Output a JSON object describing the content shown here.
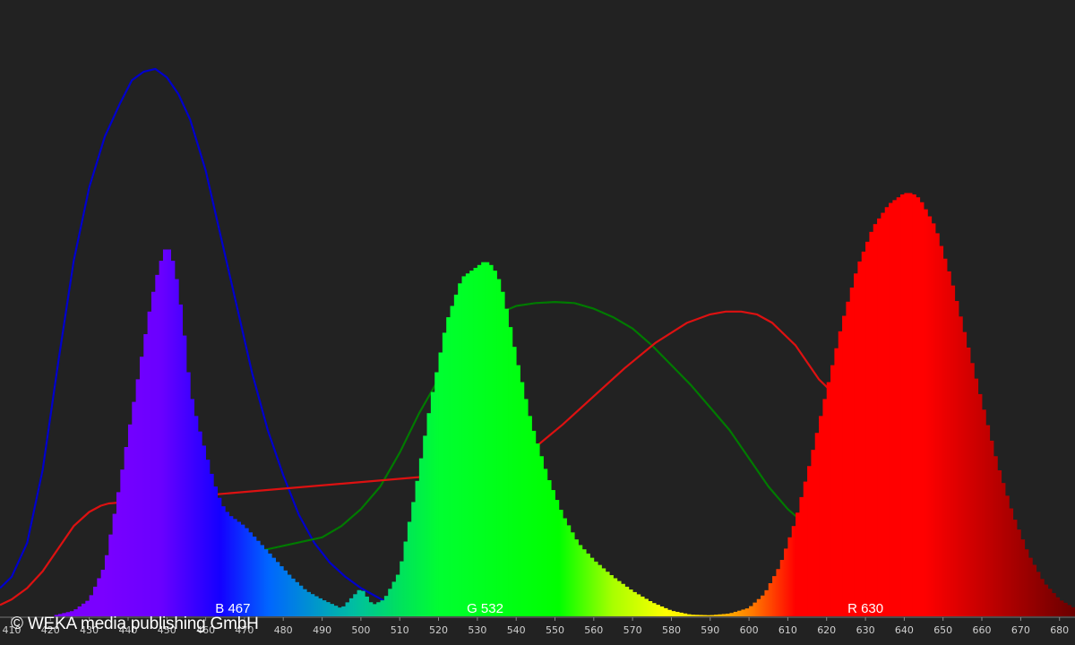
{
  "copyright": "© WEKA media publishing GmbH",
  "chart_data": {
    "type": "area",
    "x_range": [
      407,
      684
    ],
    "y_range": [
      0,
      1
    ],
    "grid": false,
    "legend": "none",
    "x_ticks": [
      410,
      420,
      430,
      440,
      450,
      460,
      470,
      480,
      490,
      500,
      510,
      520,
      530,
      540,
      550,
      560,
      570,
      580,
      590,
      600,
      610,
      620,
      630,
      640,
      650,
      660,
      670,
      680
    ],
    "x_tick_labels": [
      "410",
      "420",
      "430",
      "440",
      "450",
      "460",
      "470",
      "480",
      "490",
      "500",
      "510",
      "520",
      "530",
      "540",
      "550",
      "560",
      "570",
      "580",
      "590",
      "600",
      "610",
      "620",
      "630",
      "640",
      "650",
      "660",
      "670",
      "680"
    ],
    "peak_labels": [
      {
        "text": "B 467",
        "x": 467,
        "color": "#ffffff"
      },
      {
        "text": "G 532",
        "x": 532,
        "color": "#ffffff"
      },
      {
        "text": "R 630",
        "x": 630,
        "color": "#ffffff"
      }
    ],
    "emission_spectrum": {
      "x": [
        407,
        420,
        426,
        430,
        434,
        437,
        440,
        443,
        446,
        448,
        450,
        452,
        454,
        456,
        458,
        460,
        462,
        464,
        466,
        470,
        474,
        478,
        482,
        486,
        490,
        495,
        500,
        503,
        506,
        510,
        514,
        518,
        522,
        526,
        530,
        532,
        534,
        536,
        538,
        540,
        544,
        548,
        552,
        556,
        560,
        565,
        570,
        575,
        580,
        585,
        590,
        595,
        600,
        604,
        608,
        612,
        616,
        620,
        624,
        628,
        632,
        636,
        640,
        642,
        644,
        648,
        652,
        656,
        660,
        664,
        668,
        672,
        676,
        680,
        684
      ],
      "y": [
        0.0,
        0.0,
        0.01,
        0.03,
        0.09,
        0.2,
        0.32,
        0.44,
        0.56,
        0.62,
        0.66,
        0.62,
        0.53,
        0.4,
        0.34,
        0.29,
        0.24,
        0.2,
        0.18,
        0.16,
        0.13,
        0.1,
        0.07,
        0.045,
        0.03,
        0.014,
        0.05,
        0.02,
        0.03,
        0.08,
        0.22,
        0.38,
        0.52,
        0.6,
        0.62,
        0.63,
        0.62,
        0.59,
        0.53,
        0.46,
        0.34,
        0.25,
        0.18,
        0.13,
        0.1,
        0.07,
        0.045,
        0.025,
        0.01,
        0.003,
        0.002,
        0.005,
        0.015,
        0.04,
        0.09,
        0.17,
        0.28,
        0.4,
        0.52,
        0.62,
        0.69,
        0.73,
        0.75,
        0.75,
        0.74,
        0.69,
        0.6,
        0.49,
        0.38,
        0.27,
        0.18,
        0.11,
        0.06,
        0.03,
        0.014
      ]
    },
    "series": [
      {
        "color": "#0000cc",
        "x": [
          407,
          410,
          414,
          418,
          422,
          426,
          430,
          434,
          438,
          441,
          444,
          447,
          450,
          453,
          456,
          460,
          464,
          468,
          472,
          476,
          480,
          484,
          488,
          492,
          496,
          500,
          504,
          508,
          509
        ],
        "y": [
          0.05,
          0.07,
          0.13,
          0.26,
          0.45,
          0.63,
          0.76,
          0.85,
          0.91,
          0.95,
          0.965,
          0.97,
          0.955,
          0.925,
          0.88,
          0.79,
          0.67,
          0.55,
          0.43,
          0.33,
          0.25,
          0.18,
          0.13,
          0.095,
          0.07,
          0.05,
          0.035,
          0.02,
          0.01
        ]
      },
      {
        "color": "#007a00",
        "x": [
          470,
          480,
          490,
          495,
          500,
          505,
          510,
          515,
          520,
          525,
          530,
          535,
          540,
          545,
          550,
          555,
          560,
          565,
          570,
          575,
          580,
          585,
          590,
          595,
          600,
          605,
          610,
          615,
          617
        ],
        "y": [
          0.11,
          0.125,
          0.14,
          0.16,
          0.19,
          0.23,
          0.29,
          0.36,
          0.42,
          0.47,
          0.51,
          0.535,
          0.55,
          0.555,
          0.557,
          0.555,
          0.545,
          0.53,
          0.51,
          0.48,
          0.445,
          0.41,
          0.37,
          0.33,
          0.28,
          0.23,
          0.19,
          0.16,
          0.15
        ]
      },
      {
        "color": "#dd1111",
        "x": [
          407,
          410,
          414,
          418,
          422,
          426,
          430,
          433,
          435,
          538,
          545,
          552,
          560,
          568,
          576,
          584,
          590,
          594,
          598,
          602,
          606,
          612,
          618,
          621
        ],
        "y": [
          0.02,
          0.03,
          0.05,
          0.08,
          0.12,
          0.16,
          0.185,
          0.196,
          0.2,
          0.26,
          0.3,
          0.34,
          0.39,
          0.44,
          0.485,
          0.52,
          0.535,
          0.54,
          0.54,
          0.535,
          0.52,
          0.48,
          0.42,
          0.4
        ]
      }
    ]
  }
}
